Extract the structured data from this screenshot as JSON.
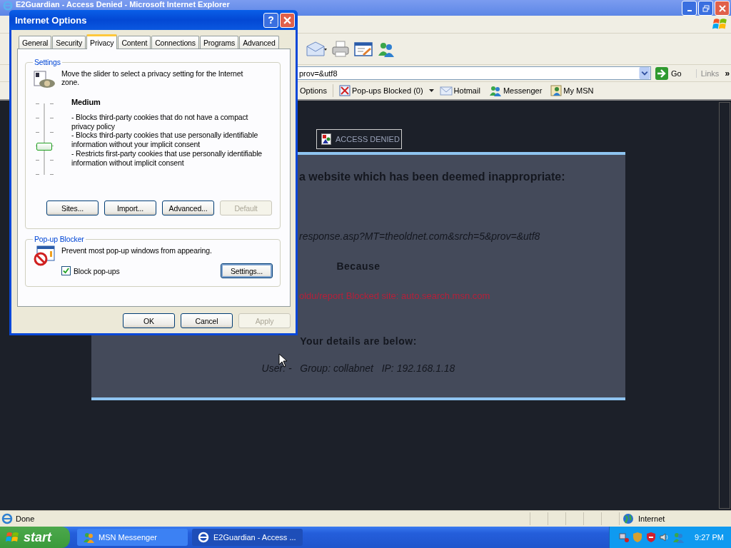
{
  "browser": {
    "title": "E2Guardian - Access Denied - Microsoft Internet Explorer",
    "address": "prov=&utf8",
    "go": "Go",
    "links": "Links",
    "links_chevron": "»",
    "links_bar": [
      {
        "kind": "text",
        "label": "Options"
      },
      {
        "kind": "popups",
        "label": "Pop-ups Blocked (0)"
      },
      {
        "kind": "mail",
        "label": "Hotmail"
      },
      {
        "kind": "messenger",
        "label": "Messenger"
      },
      {
        "kind": "person",
        "label": "My MSN"
      }
    ]
  },
  "page": {
    "banner": "ACCESS DENIED",
    "heading": "a website which has been deemed inappropriate:",
    "url": "response.asp?MT=theoldnet.com&srch=5&prov=&utf8",
    "because_label": "Because",
    "reason": "oldu/report  Blocked site: auto.search.msn.com",
    "details_heading": "Your details are below:",
    "details": "User: -   Group: collabnet   IP: 192.168.1.18"
  },
  "status_bar": {
    "text": "Done",
    "zone": "Internet"
  },
  "dialog": {
    "title": "Internet Options",
    "help": "?",
    "tabs": [
      {
        "label": "General",
        "selected": false
      },
      {
        "label": "Security",
        "selected": false
      },
      {
        "label": "Privacy",
        "selected": true
      },
      {
        "label": "Content",
        "selected": false
      },
      {
        "label": "Connections",
        "selected": false
      },
      {
        "label": "Programs",
        "selected": false
      },
      {
        "label": "Advanced",
        "selected": false
      }
    ],
    "settings": {
      "legend": "Settings",
      "intro": "Move the slider to select a privacy setting for the Internet zone.",
      "slider": {
        "level": 0.4
      },
      "level_name": "Medium",
      "bullets": [
        "- Blocks third-party cookies that do not have a compact privacy policy",
        "- Blocks third-party cookies that use personally identifiable information without your implicit consent",
        "- Restricts first-party cookies that use personally identifiable information without implicit consent"
      ],
      "buttons": [
        {
          "label": "Sites...",
          "disabled": false
        },
        {
          "label": "Import...",
          "disabled": false
        },
        {
          "label": "Advanced...",
          "disabled": false
        },
        {
          "label": "Default",
          "disabled": true
        }
      ]
    },
    "popup_blocker": {
      "legend": "Pop-up Blocker",
      "text": "Prevent most pop-up windows from appearing.",
      "checkbox": {
        "label": "Block pop-ups",
        "checked": true
      },
      "settings_button": "Settings..."
    },
    "buttons": [
      {
        "label": "OK",
        "disabled": false
      },
      {
        "label": "Cancel",
        "disabled": false
      },
      {
        "label": "Apply",
        "disabled": true
      }
    ]
  },
  "taskbar": {
    "start": "start",
    "tasks": [
      {
        "label": "MSN Messenger",
        "selected": false
      },
      {
        "label": "E2Guardian - Access ...",
        "selected": true
      }
    ],
    "clock": "9:27 PM"
  }
}
